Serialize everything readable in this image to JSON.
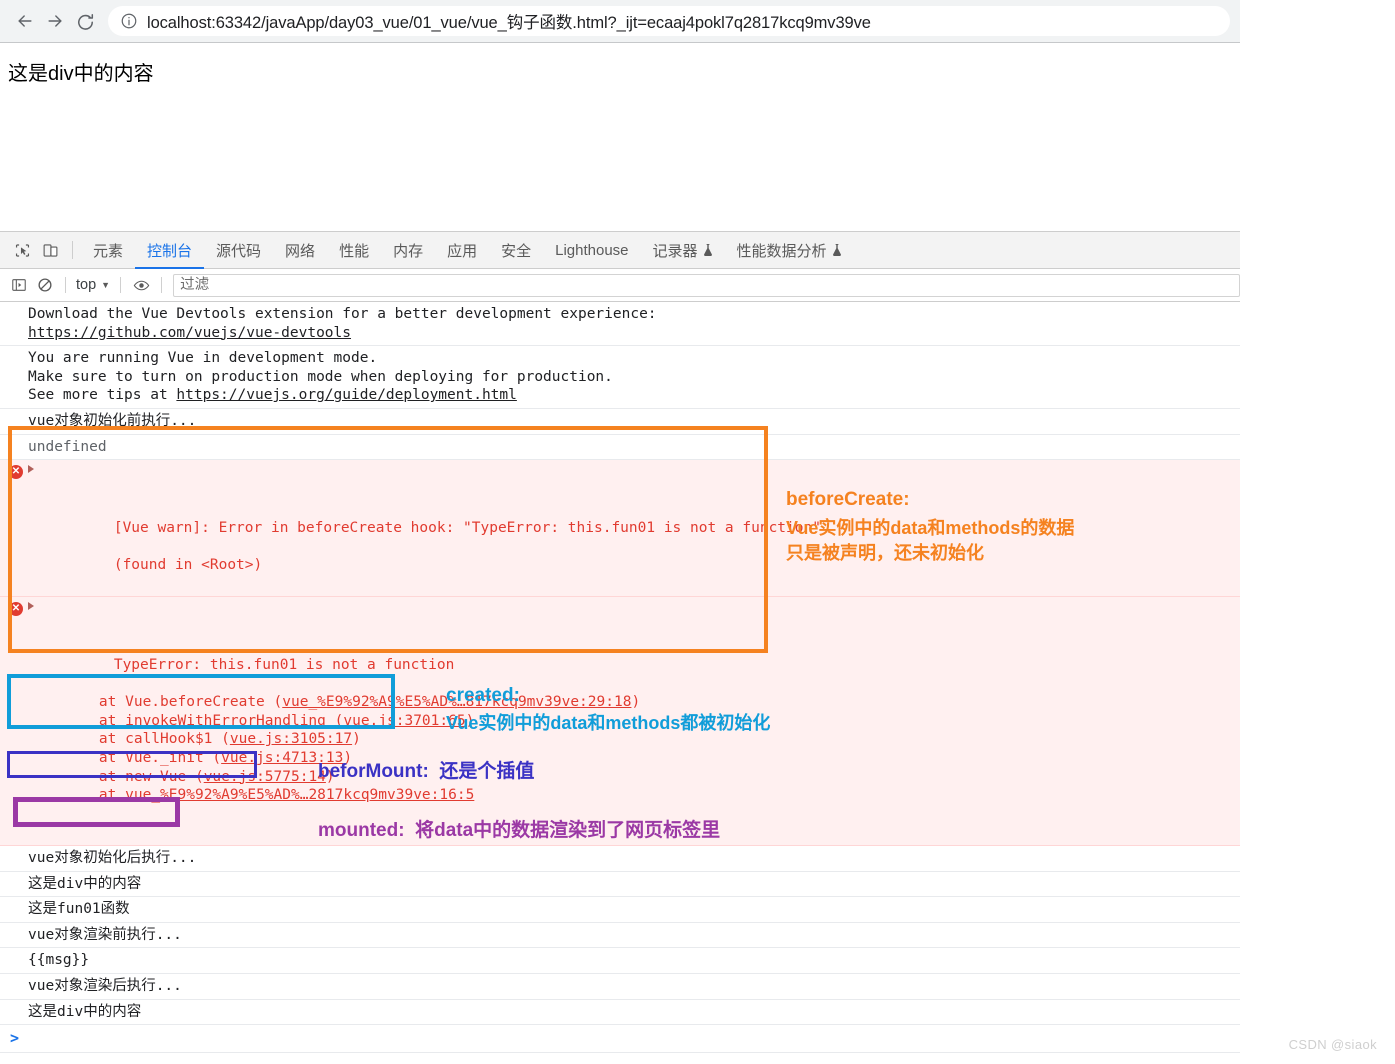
{
  "browser": {
    "back_label": "Back",
    "forward_label": "Forward",
    "reload_label": "Reload",
    "site_info_label": "View site information",
    "url": "localhost:63342/javaApp/day03_vue/01_vue/vue_钩子函数.html?_ijt=ecaaj4pokl7q2817kcq9mv39ve"
  },
  "page": {
    "div_content": "这是div中的内容"
  },
  "devtools": {
    "inspect_icon_label": "检查元素",
    "device_icon_label": "切换设备工具栏",
    "tabs": [
      {
        "label": "元素",
        "active": false,
        "flask": false
      },
      {
        "label": "控制台",
        "active": true,
        "flask": false
      },
      {
        "label": "源代码",
        "active": false,
        "flask": false
      },
      {
        "label": "网络",
        "active": false,
        "flask": false
      },
      {
        "label": "性能",
        "active": false,
        "flask": false
      },
      {
        "label": "内存",
        "active": false,
        "flask": false
      },
      {
        "label": "应用",
        "active": false,
        "flask": false
      },
      {
        "label": "安全",
        "active": false,
        "flask": false
      },
      {
        "label": "Lighthouse",
        "active": false,
        "flask": false
      },
      {
        "label": "记录器",
        "active": false,
        "flask": true
      },
      {
        "label": "性能数据分析",
        "active": false,
        "flask": true
      }
    ],
    "filterbar": {
      "sidebar_toggle_label": "显示控制台侧边栏",
      "clear_label": "清除控制台",
      "context": "top",
      "eye_label": "创建实时表达式",
      "filter_placeholder": "过滤",
      "filter_value": ""
    }
  },
  "console": {
    "rows": [
      {
        "id": "vue-devtools",
        "type": "log",
        "lines": [
          {
            "text": "Download the Vue Devtools extension for a better development experience:",
            "link": false
          },
          {
            "text": "https://github.com/vuejs/vue-devtools",
            "link": true
          }
        ]
      },
      {
        "id": "dev-mode",
        "type": "log",
        "lines": [
          {
            "text": "You are running Vue in development mode.",
            "link": false
          },
          {
            "text": "Make sure to turn on production mode when deploying for production.",
            "link": false
          },
          {
            "text": "See more tips at ",
            "link": false,
            "suffix_link": "https://vuejs.org/guide/deployment.html"
          }
        ]
      },
      {
        "id": "before-create-log",
        "type": "log",
        "lines": [
          {
            "text": "vue对象初始化前执行...",
            "link": false
          }
        ]
      },
      {
        "id": "undefined-row",
        "type": "grey",
        "lines": [
          {
            "text": "undefined",
            "link": false
          }
        ]
      },
      {
        "id": "vue-warn",
        "type": "error",
        "lines": [
          {
            "text": "[Vue warn]: Error in beforeCreate hook: \"TypeError: this.fun01 is not a function\"",
            "link": false
          },
          {
            "text": "",
            "link": false
          },
          {
            "text": "(found in <Root>)",
            "link": false
          }
        ]
      },
      {
        "id": "type-error",
        "type": "error",
        "lines": [
          {
            "text": "TypeError: this.fun01 is not a function",
            "link": false
          },
          {
            "text": "    at Vue.beforeCreate (",
            "link": false,
            "linked": "vue_%E9%92%A9%E5%AD%…817kcq9mv39ve:29:18",
            "tail": ")"
          },
          {
            "text": "    at invokeWithErrorHandling (",
            "link": false,
            "linked": "vue.js:3701:65",
            "tail": ")"
          },
          {
            "text": "    at callHook$1 (",
            "link": false,
            "linked": "vue.js:3105:17",
            "tail": ")"
          },
          {
            "text": "    at Vue._init (",
            "link": false,
            "linked": "vue.js:4713:13",
            "tail": ")"
          },
          {
            "text": "    at new Vue (",
            "link": false,
            "linked": "vue.js:5775:14",
            "tail": ")"
          },
          {
            "text": "    at ",
            "link": false,
            "linked": "vue_%E9%92%A9%E5%AD%…2817kcq9mv39ve:16:5",
            "tail": ""
          }
        ]
      },
      {
        "id": "created-log",
        "type": "log",
        "lines": [
          {
            "text": "vue对象初始化后执行...",
            "link": false
          }
        ]
      },
      {
        "id": "msg-log",
        "type": "log",
        "lines": [
          {
            "text": "这是div中的内容",
            "link": false
          }
        ]
      },
      {
        "id": "fun01-log",
        "type": "log",
        "lines": [
          {
            "text": "这是fun01函数",
            "link": false
          }
        ]
      },
      {
        "id": "before-mount-log",
        "type": "log",
        "lines": [
          {
            "text": "vue对象渲染前执行...",
            "link": false
          }
        ]
      },
      {
        "id": "mustache-log",
        "type": "log",
        "lines": [
          {
            "text": "{{msg}}",
            "link": false
          }
        ]
      },
      {
        "id": "mounted-log",
        "type": "log",
        "lines": [
          {
            "text": "vue对象渲染后执行...",
            "link": false
          }
        ]
      },
      {
        "id": "rendered-log",
        "type": "log",
        "lines": [
          {
            "text": "这是div中的内容",
            "link": false
          }
        ]
      }
    ]
  },
  "annotations": [
    {
      "id": "before-create",
      "color": "#F58220",
      "title": "beforeCreate:",
      "body": "Vue实例中的data和methods的数据\n只是被声明，还未初始化"
    },
    {
      "id": "created",
      "color": "#119DD9",
      "title": "created:",
      "body": "Vue实例中的data和methods都被初始化"
    },
    {
      "id": "before-mount",
      "color": "#3B32C4",
      "title": "beforMount:",
      "body": "还是个插值"
    },
    {
      "id": "mounted",
      "color": "#9B39A5",
      "title": "mounted:",
      "body": "将data中的数据渲染到了网页标签里"
    }
  ],
  "watermark": "CSDN @siaok"
}
